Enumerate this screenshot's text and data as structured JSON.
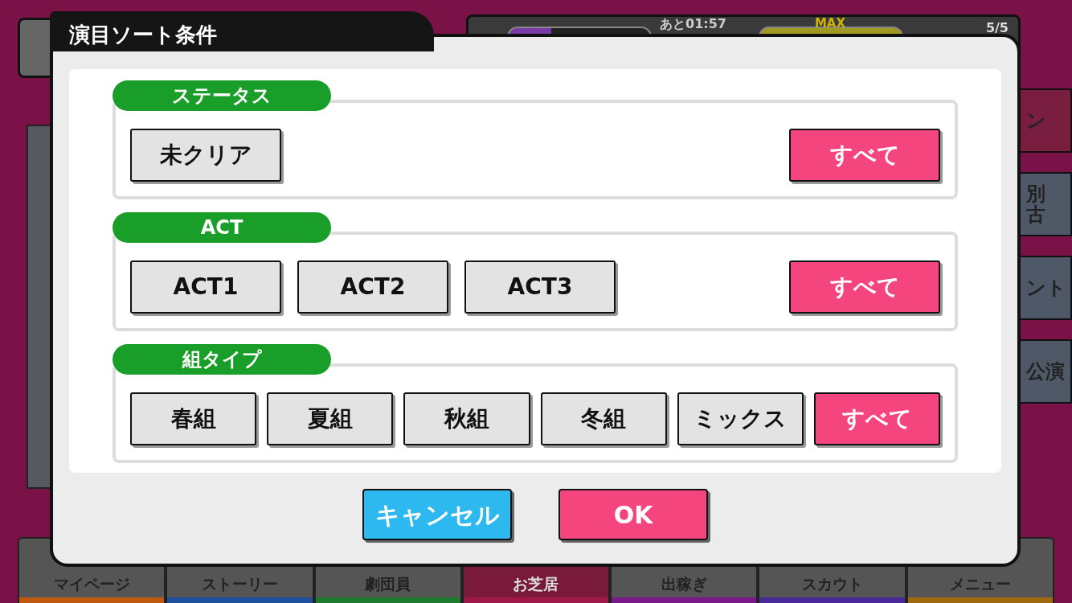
{
  "status_bar": {
    "timer": "あと01:57",
    "sp_badge": "MAX",
    "count": "5/5"
  },
  "side_menu": [
    {
      "lines": [
        "ン"
      ],
      "selected": true
    },
    {
      "lines": [
        "別",
        "古"
      ],
      "selected": false
    },
    {
      "lines": [
        "ント"
      ],
      "selected": false
    },
    {
      "lines": [
        "公演"
      ],
      "selected": false
    }
  ],
  "dialog": {
    "title": "演目ソート条件",
    "sections": [
      {
        "label": "ステータス",
        "options": [
          {
            "label": "未クリア",
            "selected": false
          },
          {
            "label": "すべて",
            "selected": true
          }
        ]
      },
      {
        "label": "ACT",
        "options": [
          {
            "label": "ACT1",
            "selected": false
          },
          {
            "label": "ACT2",
            "selected": false
          },
          {
            "label": "ACT3",
            "selected": false
          },
          {
            "label": "すべて",
            "selected": true
          }
        ]
      },
      {
        "label": "組タイプ",
        "options": [
          {
            "label": "春組",
            "selected": false
          },
          {
            "label": "夏組",
            "selected": false
          },
          {
            "label": "秋組",
            "selected": false
          },
          {
            "label": "冬組",
            "selected": false
          },
          {
            "label": "ミックス",
            "selected": false
          },
          {
            "label": "すべて",
            "selected": true
          }
        ]
      }
    ],
    "buttons": [
      {
        "label": "キャンセル",
        "kind": "cancel"
      },
      {
        "label": "OK",
        "kind": "ok"
      }
    ]
  },
  "bottom_nav": [
    {
      "label": "マイページ",
      "selected": false,
      "color": "#c05a10"
    },
    {
      "label": "ストーリー",
      "selected": false,
      "color": "#1d4f9a"
    },
    {
      "label": "劇団員",
      "selected": false,
      "color": "#1d7a2e"
    },
    {
      "label": "お芝居",
      "selected": true,
      "color": "#a01848"
    },
    {
      "label": "出稼ぎ",
      "selected": false,
      "color": "#7a1a8a"
    },
    {
      "label": "スカウト",
      "selected": false,
      "color": "#4a2a9a"
    },
    {
      "label": "メニュー",
      "selected": false,
      "color": "#a06a10"
    }
  ]
}
